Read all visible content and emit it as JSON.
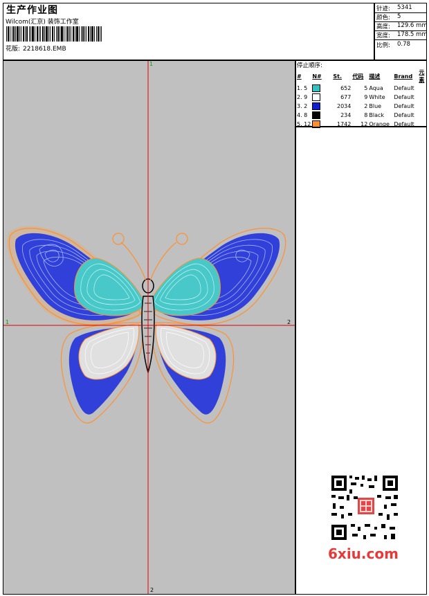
{
  "header": {
    "title": "生产作业图",
    "company": "Wilcom(汇京) 装饰工作室",
    "design_label": "花版:",
    "design_file": "2218618.EMB"
  },
  "stats": {
    "stitches_label": "针迹:",
    "stitches": "5341",
    "colors_label": "颜色:",
    "colors": "5",
    "height_label": "高度:",
    "height": "129.6 mm",
    "width_label": "宽度:",
    "width": "178.5 mm",
    "scale_label": "比例:",
    "scale": "0.78"
  },
  "stop_sequence": {
    "title": "停止顺序:",
    "headers": [
      "#",
      "N#",
      "St.",
      "代码",
      "描述",
      "Brand",
      "元素"
    ],
    "rows": [
      {
        "idx": "1.",
        "n": "5",
        "color": "#33c0c0",
        "st": "652",
        "code": "5",
        "desc": "Aqua",
        "brand": "Default"
      },
      {
        "idx": "2.",
        "n": "9",
        "color": "#ffffff",
        "st": "677",
        "code": "9",
        "desc": "White",
        "brand": "Default"
      },
      {
        "idx": "3.",
        "n": "2",
        "color": "#1020d0",
        "st": "2034",
        "code": "2",
        "desc": "Blue",
        "brand": "Default"
      },
      {
        "idx": "4.",
        "n": "8",
        "color": "#000000",
        "st": "234",
        "code": "8",
        "desc": "Black",
        "brand": "Default"
      },
      {
        "idx": "5.",
        "n": "12",
        "color": "#ff9030",
        "st": "1742",
        "code": "12",
        "desc": "Orange",
        "brand": "Default"
      }
    ]
  },
  "canvas": {
    "axis_top": "1",
    "axis_bottom": "2",
    "axis_left": "1",
    "axis_right": "2"
  },
  "watermark": {
    "site": "6xiu.com"
  }
}
